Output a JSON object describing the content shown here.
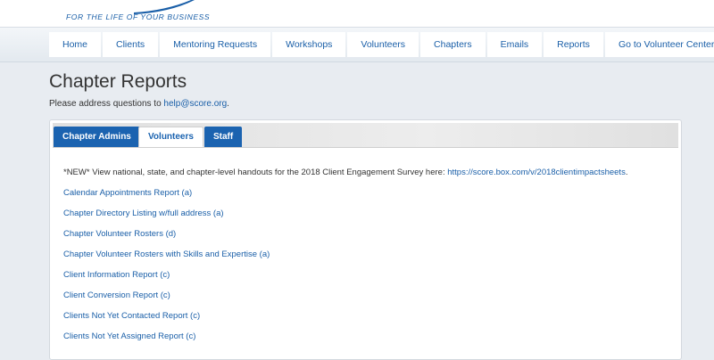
{
  "header": {
    "tagline": "FOR THE LIFE OF YOUR BUSINESS"
  },
  "nav": {
    "items": [
      {
        "label": "Home"
      },
      {
        "label": "Clients"
      },
      {
        "label": "Mentoring Requests"
      },
      {
        "label": "Workshops"
      },
      {
        "label": "Volunteers"
      },
      {
        "label": "Chapters"
      },
      {
        "label": "Emails"
      },
      {
        "label": "Reports"
      },
      {
        "label": "Go to Volunteer Center"
      }
    ]
  },
  "page": {
    "title": "Chapter Reports",
    "help_prefix": "Please address questions to ",
    "help_email": "help@score.org",
    "help_suffix": "."
  },
  "tabs": [
    {
      "label": "Chapter Admins",
      "active": false
    },
    {
      "label": "Volunteers",
      "active": true
    },
    {
      "label": "Staff",
      "active": false
    }
  ],
  "notice": {
    "text": "*NEW* View national, state, and chapter-level handouts for the 2018 Client Engagement Survey here: ",
    "link": "https://score.box.com/v/2018clientimpactsheets",
    "suffix": "."
  },
  "reports": [
    "Calendar Appointments Report (a)",
    "Chapter Directory Listing w/full address (a)",
    "Chapter Volunteer Rosters (d)",
    "Chapter Volunteer Rosters with Skills and Expertise (a)",
    "Client Information Report (c)",
    "Client Conversion Report (c)",
    "Clients Not Yet Contacted Report (c)",
    "Clients Not Yet Assigned Report (c)"
  ],
  "colors": {
    "brand_blue": "#1b63b0",
    "link_blue": "#1a5fa8"
  }
}
